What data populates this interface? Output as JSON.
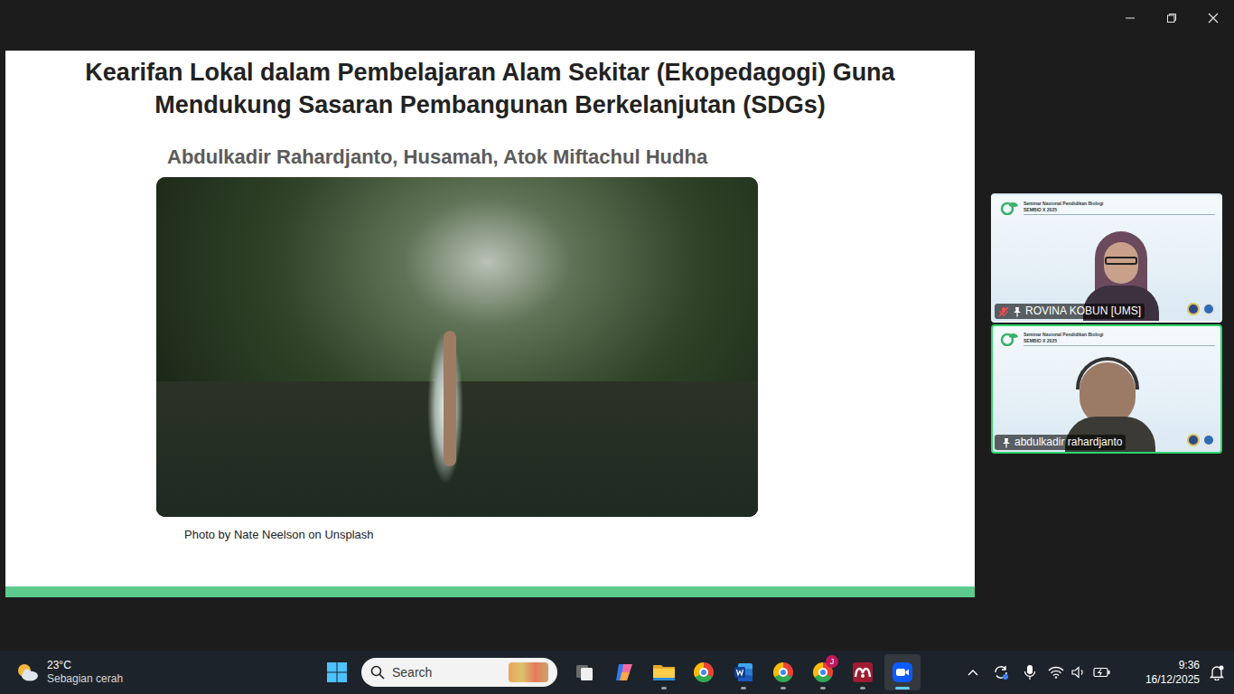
{
  "slide": {
    "title": "Kearifan Lokal dalam Pembelajaran Alam Sekitar (Ekopedagogi) Guna Mendukung Sasaran Pembangunan Berkelanjutan (SDGs)",
    "authors": "Abdulkadir Rahardjanto, Husamah, Atok Miftachul Hudha",
    "caption": "Photo by Nate Neelson on Unsplash"
  },
  "participants": [
    {
      "name": "ROVINA KOBUN [UMS]",
      "muted": true,
      "speaking": false,
      "banner_title": "Seminar Nasional Pendidikan Biologi",
      "banner_subtitle": "SEMBIO X 2025"
    },
    {
      "name": "abdulkadir rahardjanto",
      "muted": false,
      "speaking": true,
      "banner_title": "Seminar Nasional Pendidikan Biologi",
      "banner_subtitle": "SEMBIO X 2025"
    }
  ],
  "taskbar": {
    "weather": {
      "temperature": "23°C",
      "condition": "Sebagian cerah"
    },
    "search": {
      "placeholder": "Search"
    },
    "apps": [
      {
        "kind": "taskview",
        "running": false,
        "active": false
      },
      {
        "kind": "copilot",
        "running": false,
        "active": false
      },
      {
        "kind": "explorer",
        "running": true,
        "active": false
      },
      {
        "kind": "chrome",
        "running": false,
        "active": false
      },
      {
        "kind": "word",
        "running": true,
        "active": false
      },
      {
        "kind": "chrome",
        "running": true,
        "active": false
      },
      {
        "kind": "chrome",
        "running": true,
        "active": false,
        "badge": "J"
      },
      {
        "kind": "mendeley",
        "running": true,
        "active": false
      },
      {
        "kind": "zoom",
        "running": true,
        "active": true
      }
    ],
    "clock": {
      "time": "9:36",
      "date": "16/12/2025"
    }
  }
}
